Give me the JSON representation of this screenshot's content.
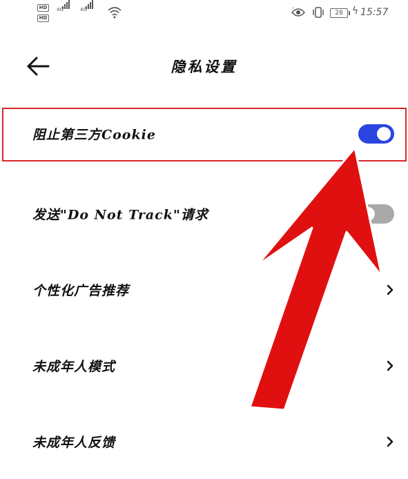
{
  "status_bar": {
    "hd_labels": [
      "HD",
      "HD"
    ],
    "network_labels": [
      "4G",
      "4G"
    ],
    "battery_level": "28",
    "time": "15:57",
    "icons": [
      "hd-badge-icon",
      "signal-icon",
      "wifi-icon",
      "eye-care-icon",
      "vibrate-icon",
      "battery-icon",
      "charging-icon"
    ]
  },
  "header": {
    "title": "隐私设置",
    "back_icon": "arrow-left-icon"
  },
  "settings": [
    {
      "label": "阻止第三方Cookie",
      "control": "toggle",
      "on": true,
      "highlighted": true
    },
    {
      "label": "发送\"Do Not Track\"请求",
      "control": "toggle",
      "on": false,
      "highlighted": false
    },
    {
      "label": "个性化广告推荐",
      "control": "chevron",
      "icon": "chevron-right-icon"
    },
    {
      "label": "未成年人模式",
      "control": "chevron",
      "icon": "chevron-right-icon"
    },
    {
      "label": "未成年人反馈",
      "control": "chevron",
      "icon": "chevron-right-icon"
    }
  ],
  "colors": {
    "toggle_on": "#2b45e0",
    "toggle_off": "#a9a9a9",
    "highlight_border": "#d62728",
    "annotation_arrow": "#e01010"
  }
}
